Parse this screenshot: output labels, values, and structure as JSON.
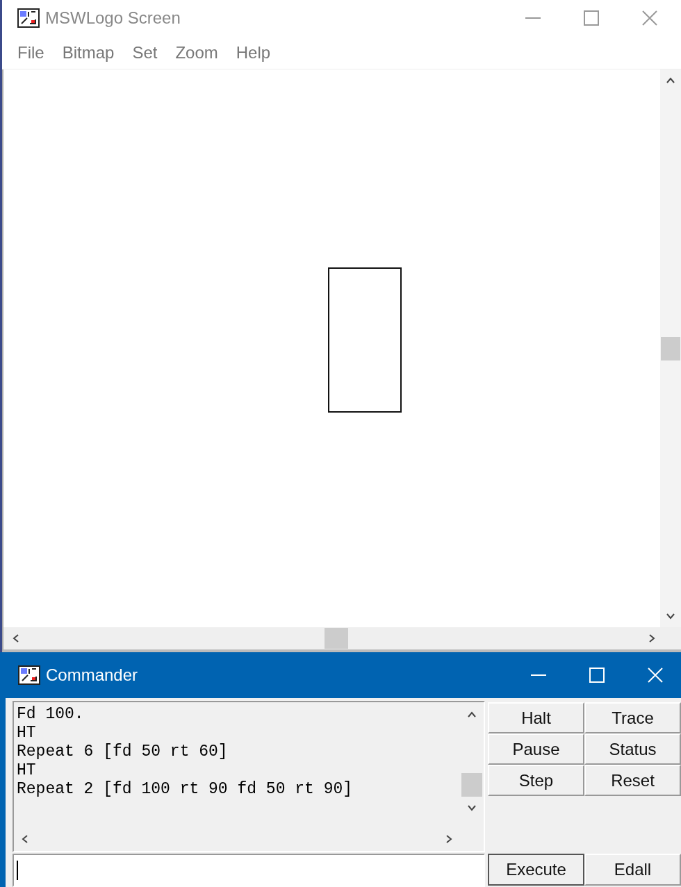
{
  "screen_window": {
    "title": "MSWLogo Screen",
    "menu": [
      "File",
      "Bitmap",
      "Set",
      "Zoom",
      "Help"
    ]
  },
  "commander": {
    "title": "Commander",
    "history": [
      "Fd 100.",
      "HT",
      "Repeat 6 [fd 50 rt 60]",
      "HT",
      "Repeat 2 [fd 100 rt 90 fd 50 rt 90]"
    ],
    "buttons": [
      "Halt",
      "Trace",
      "Pause",
      "Status",
      "Step",
      "Reset"
    ],
    "bottom_buttons": [
      "Execute",
      "Edall"
    ]
  }
}
